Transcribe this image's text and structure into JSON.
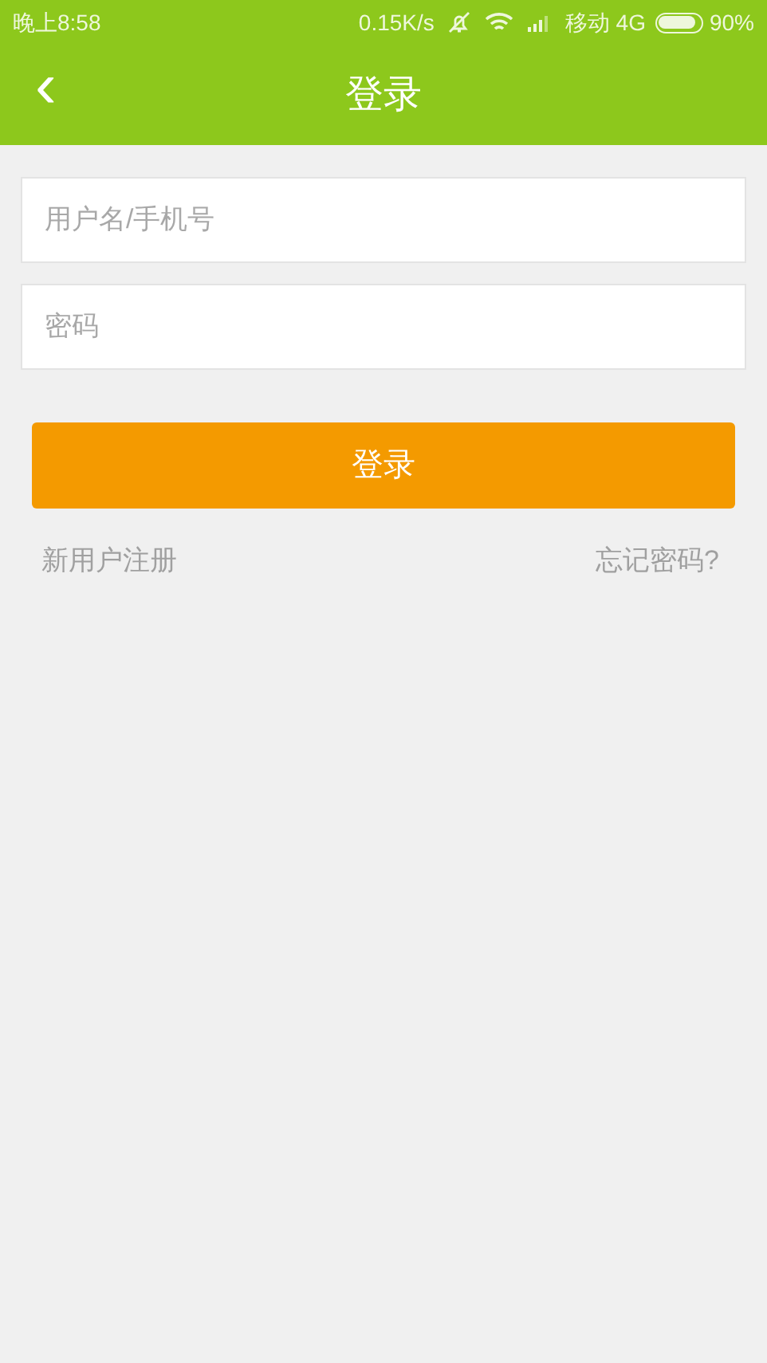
{
  "status_bar": {
    "time": "晚上8:58",
    "speed": "0.15K/s",
    "carrier": "移动 4G",
    "battery": "90%"
  },
  "header": {
    "back": "‹",
    "title": "登录"
  },
  "form": {
    "username": {
      "placeholder": "用户名/手机号"
    },
    "password": {
      "placeholder": "密码"
    },
    "submit": "登录"
  },
  "links": {
    "register": "新用户注册",
    "forgot": "忘记密码?"
  }
}
